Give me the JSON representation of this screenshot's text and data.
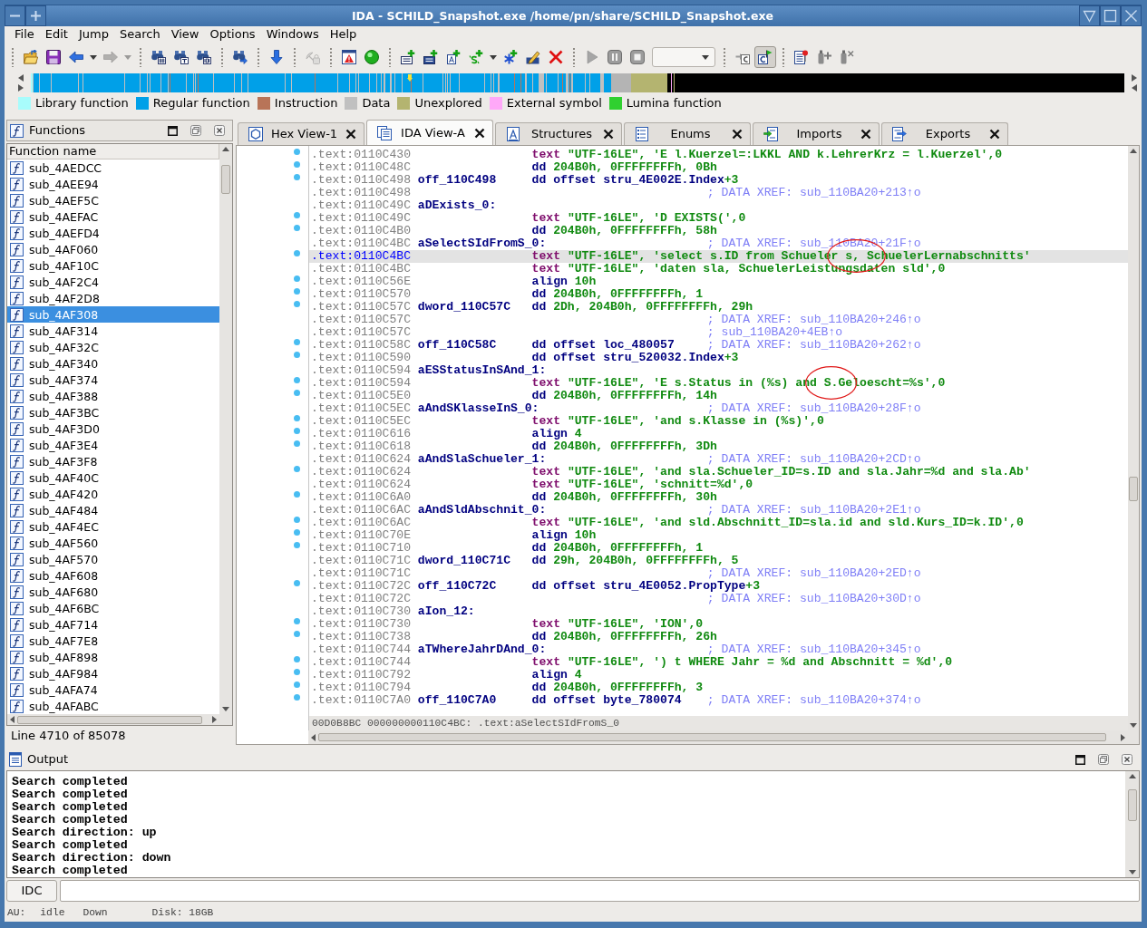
{
  "window": {
    "title": "IDA - SCHILD_Snapshot.exe /home/pn/share/SCHILD_Snapshot.exe"
  },
  "menu": [
    "File",
    "Edit",
    "Jump",
    "Search",
    "View",
    "Options",
    "Windows",
    "Help"
  ],
  "toolbar": [
    [
      {
        "kind": "folder",
        "disabled": false,
        "pressed": false
      },
      {
        "kind": "floppy",
        "disabled": false,
        "pressed": false
      },
      {
        "kind": "back",
        "disabled": false,
        "pressed": false
      },
      {
        "kind": "caret",
        "disabled": false,
        "pressed": false
      },
      {
        "kind": "forward",
        "disabled": true,
        "pressed": false
      },
      {
        "kind": "caret",
        "disabled": true,
        "pressed": false
      }
    ],
    [
      {
        "kind": "findhex",
        "disabled": false,
        "pressed": false
      },
      {
        "kind": "findtext",
        "disabled": false,
        "pressed": false
      },
      {
        "kind": "findnum",
        "disabled": false,
        "pressed": false
      }
    ],
    [
      {
        "kind": "findnext",
        "disabled": false,
        "pressed": false
      }
    ],
    [
      {
        "kind": "jumpdown",
        "disabled": false,
        "pressed": false
      }
    ],
    [
      {
        "kind": "satellite",
        "disabled": true,
        "pressed": false
      }
    ],
    [
      {
        "kind": "warning",
        "disabled": false,
        "pressed": false
      },
      {
        "kind": "greendot",
        "disabled": false,
        "pressed": false
      }
    ],
    [
      {
        "kind": "code",
        "disabled": false,
        "pressed": false
      },
      {
        "kind": "data",
        "disabled": false,
        "pressed": false
      },
      {
        "kind": "struct",
        "disabled": false,
        "pressed": false
      },
      {
        "kind": "string",
        "disabled": false,
        "pressed": false
      },
      {
        "kind": "caret",
        "disabled": false,
        "pressed": false
      },
      {
        "kind": "asterisk",
        "disabled": false,
        "pressed": false
      },
      {
        "kind": "pencil",
        "disabled": false,
        "pressed": false
      },
      {
        "kind": "undefine",
        "disabled": false,
        "pressed": false
      }
    ],
    [
      {
        "kind": "play",
        "disabled": false,
        "pressed": false
      },
      {
        "kind": "pause",
        "disabled": false,
        "pressed": false
      },
      {
        "kind": "stop",
        "disabled": false,
        "pressed": false
      },
      {
        "kind": "combo",
        "disabled": false,
        "pressed": false
      }
    ],
    [
      {
        "kind": "gotoc",
        "disabled": false,
        "pressed": false
      },
      {
        "kind": "cflag",
        "disabled": false,
        "pressed": true
      }
    ],
    [
      {
        "kind": "pindoc",
        "disabled": false,
        "pressed": false
      },
      {
        "kind": "plugadd",
        "disabled": false,
        "pressed": false
      },
      {
        "kind": "plugdel",
        "disabled": false,
        "pressed": false
      }
    ]
  ],
  "legend": [
    {
      "label": "Library function",
      "color": "#a8fcfc"
    },
    {
      "label": "Regular function",
      "color": "#00a0e8"
    },
    {
      "label": "Instruction",
      "color": "#b87458"
    },
    {
      "label": "Data",
      "color": "#c0c0c0"
    },
    {
      "label": "Unexplored",
      "color": "#b4b470"
    },
    {
      "label": "External symbol",
      "color": "#ffa8f8"
    },
    {
      "label": "Lumina function",
      "color": "#30d030"
    }
  ],
  "functions_panel": {
    "title": "Functions",
    "column": "Function name",
    "items": [
      {
        "name": "sub_4AEDCC",
        "selected": false
      },
      {
        "name": "sub_4AEE94",
        "selected": false
      },
      {
        "name": "sub_4AEF5C",
        "selected": false
      },
      {
        "name": "sub_4AEFAC",
        "selected": false
      },
      {
        "name": "sub_4AEFD4",
        "selected": false
      },
      {
        "name": "sub_4AF060",
        "selected": false
      },
      {
        "name": "sub_4AF10C",
        "selected": false
      },
      {
        "name": "sub_4AF2C4",
        "selected": false
      },
      {
        "name": "sub_4AF2D8",
        "selected": false
      },
      {
        "name": "sub_4AF308",
        "selected": true
      },
      {
        "name": "sub_4AF314",
        "selected": false
      },
      {
        "name": "sub_4AF32C",
        "selected": false
      },
      {
        "name": "sub_4AF340",
        "selected": false
      },
      {
        "name": "sub_4AF374",
        "selected": false
      },
      {
        "name": "sub_4AF388",
        "selected": false
      },
      {
        "name": "sub_4AF3BC",
        "selected": false
      },
      {
        "name": "sub_4AF3D0",
        "selected": false
      },
      {
        "name": "sub_4AF3E4",
        "selected": false
      },
      {
        "name": "sub_4AF3F8",
        "selected": false
      },
      {
        "name": "sub_4AF40C",
        "selected": false
      },
      {
        "name": "sub_4AF420",
        "selected": false
      },
      {
        "name": "sub_4AF484",
        "selected": false
      },
      {
        "name": "sub_4AF4EC",
        "selected": false
      },
      {
        "name": "sub_4AF560",
        "selected": false
      },
      {
        "name": "sub_4AF570",
        "selected": false
      },
      {
        "name": "sub_4AF608",
        "selected": false
      },
      {
        "name": "sub_4AF680",
        "selected": false
      },
      {
        "name": "sub_4AF6BC",
        "selected": false
      },
      {
        "name": "sub_4AF714",
        "selected": false
      },
      {
        "name": "sub_4AF7E8",
        "selected": false
      },
      {
        "name": "sub_4AF898",
        "selected": false
      },
      {
        "name": "sub_4AF984",
        "selected": false
      },
      {
        "name": "sub_4AFA74",
        "selected": false
      },
      {
        "name": "sub_4AFABC",
        "selected": false
      }
    ],
    "footer": "Line 4710 of 85078"
  },
  "tabs": [
    {
      "label": "Hex View-1",
      "kind": "hex",
      "selected": false
    },
    {
      "label": "IDA View-A",
      "kind": "disasm",
      "selected": true
    },
    {
      "label": "Structures",
      "kind": "struct",
      "selected": false
    },
    {
      "label": "Enums",
      "kind": "enum",
      "selected": false
    },
    {
      "label": "Imports",
      "kind": "import",
      "selected": false
    },
    {
      "label": "Exports",
      "kind": "export",
      "selected": false
    }
  ],
  "code_view": {
    "lines": [
      {
        "address": ".text:0110C430",
        "kind": "string",
        "mnemonic": "text",
        "operands": [
          {
            "text": "\"UTF-16LE\", 'E l.Kuerzel=:LKKL AND k.LehrerKrz = l.Kuerzel',0",
            "kind": "literal"
          }
        ],
        "marked": true,
        "selected": false
      },
      {
        "address": ".text:0110C48C",
        "kind": "data",
        "mnemonic": "dd",
        "operands": [
          {
            "text": "204B0h, 0FFFFFFFFh, 0Bh",
            "kind": "literal"
          }
        ],
        "marked": true,
        "selected": false
      },
      {
        "address": ".text:0110C498",
        "kind": "data",
        "label": "off_110C498",
        "mnemonic": "dd",
        "operands": [
          {
            "text": "offset stru_4E002E.Index",
            "kind": "name"
          },
          {
            "text": "+3",
            "kind": "literal"
          }
        ],
        "marked": true,
        "selected": false
      },
      {
        "address": ".text:0110C498",
        "kind": "comment",
        "comment": "; DATA XREF: sub_110BA20+213↑o",
        "marked": false,
        "selected": false
      },
      {
        "address": ".text:0110C49C",
        "kind": "label",
        "label": "aDExists_0:",
        "marked": false,
        "selected": false
      },
      {
        "address": ".text:0110C49C",
        "kind": "string",
        "mnemonic": "text",
        "operands": [
          {
            "text": "\"UTF-16LE\", 'D EXISTS(',0",
            "kind": "literal"
          }
        ],
        "marked": true,
        "selected": false
      },
      {
        "address": ".text:0110C4B0",
        "kind": "data",
        "mnemonic": "dd",
        "operands": [
          {
            "text": "204B0h, 0FFFFFFFFh, 58h",
            "kind": "literal"
          }
        ],
        "marked": true,
        "selected": false
      },
      {
        "address": ".text:0110C4BC",
        "kind": "label",
        "label": "aSelectSIdFromS_0:",
        "comment": "; DATA XREF: sub_110BA20+21F↑o",
        "marked": false,
        "selected": false
      },
      {
        "address": ".text:0110C4BC",
        "kind": "string",
        "mnemonic": "text",
        "operands": [
          {
            "text": "\"UTF-16LE\", 'select s.ID from Schuele",
            "kind": "literal"
          },
          {
            "text": "r s, Sc",
            "kind": "circled"
          },
          {
            "text": "huelerLernabschnitts'",
            "kind": "literal"
          }
        ],
        "marked": true,
        "selected": true
      },
      {
        "address": ".text:0110C4BC",
        "kind": "string",
        "mnemonic": "text",
        "operands": [
          {
            "text": "\"UTF-16LE\", 'daten sla, SchuelerLeistungsdaten sld',0",
            "kind": "literal"
          }
        ],
        "marked": false,
        "selected": false
      },
      {
        "address": ".text:0110C56E",
        "kind": "data",
        "mnemonic": "align",
        "operands": [
          {
            "text": "10h",
            "kind": "literal"
          }
        ],
        "marked": true,
        "selected": false
      },
      {
        "address": ".text:0110C570",
        "kind": "data",
        "mnemonic": "dd",
        "operands": [
          {
            "text": "204B0h, 0FFFFFFFFh, 1",
            "kind": "literal"
          }
        ],
        "marked": true,
        "selected": false
      },
      {
        "address": ".text:0110C57C",
        "kind": "data",
        "label": "dword_110C57C",
        "mnemonic": "dd",
        "operands": [
          {
            "text": "2Dh, 204B0h, 0FFFFFFFFh, 29h",
            "kind": "literal"
          }
        ],
        "marked": true,
        "selected": false
      },
      {
        "address": ".text:0110C57C",
        "kind": "comment",
        "comment": "; DATA XREF: sub_110BA20+246↑o",
        "marked": false,
        "selected": false
      },
      {
        "address": ".text:0110C57C",
        "kind": "comment",
        "comment": "; sub_110BA20+4EB↑o",
        "marked": false,
        "selected": false
      },
      {
        "address": ".text:0110C58C",
        "kind": "data",
        "label": "off_110C58C",
        "mnemonic": "dd",
        "operands": [
          {
            "text": "offset loc_480057",
            "kind": "name"
          }
        ],
        "comment": "; DATA XREF: sub_110BA20+262↑o",
        "marked": true,
        "selected": false
      },
      {
        "address": ".text:0110C590",
        "kind": "data",
        "mnemonic": "dd",
        "operands": [
          {
            "text": "offset stru_520032.Index",
            "kind": "name"
          },
          {
            "text": "+3",
            "kind": "literal"
          }
        ],
        "marked": true,
        "selected": false
      },
      {
        "address": ".text:0110C594",
        "kind": "label",
        "label": "aESStatusInSAnd_1:",
        "marked": false,
        "selected": false
      },
      {
        "address": ".text:0110C594",
        "kind": "string",
        "mnemonic": "text",
        "operands": [
          {
            "text": "\"UTF-16LE\", 'E s.Status in (%s) an",
            "kind": "literal"
          },
          {
            "text": "d S.Ge",
            "kind": "circled"
          },
          {
            "text": "loescht=%s',0",
            "kind": "literal"
          }
        ],
        "marked": true,
        "selected": false
      },
      {
        "address": ".text:0110C5E0",
        "kind": "data",
        "mnemonic": "dd",
        "operands": [
          {
            "text": "204B0h, 0FFFFFFFFh, 14h",
            "kind": "literal"
          }
        ],
        "marked": true,
        "selected": false
      },
      {
        "address": ".text:0110C5EC",
        "kind": "label",
        "label": "aAndSKlasseInS_0:",
        "comment": "; DATA XREF: sub_110BA20+28F↑o",
        "marked": false,
        "selected": false
      },
      {
        "address": ".text:0110C5EC",
        "kind": "string",
        "mnemonic": "text",
        "operands": [
          {
            "text": "\"UTF-16LE\", 'and s.Klasse in (%s)',0",
            "kind": "literal"
          }
        ],
        "marked": true,
        "selected": false
      },
      {
        "address": ".text:0110C616",
        "kind": "data",
        "mnemonic": "align",
        "operands": [
          {
            "text": "4",
            "kind": "literal"
          }
        ],
        "marked": true,
        "selected": false
      },
      {
        "address": ".text:0110C618",
        "kind": "data",
        "mnemonic": "dd",
        "operands": [
          {
            "text": "204B0h, 0FFFFFFFFh, 3Dh",
            "kind": "literal"
          }
        ],
        "marked": true,
        "selected": false
      },
      {
        "address": ".text:0110C624",
        "kind": "label",
        "label": "aAndSlaSchueler_1:",
        "comment": "; DATA XREF: sub_110BA20+2CD↑o",
        "marked": false,
        "selected": false
      },
      {
        "address": ".text:0110C624",
        "kind": "string",
        "mnemonic": "text",
        "operands": [
          {
            "text": "\"UTF-16LE\", 'and sla.Schueler_ID=s.ID and sla.Jahr=%d and sla.Ab'",
            "kind": "literal"
          }
        ],
        "marked": true,
        "selected": false
      },
      {
        "address": ".text:0110C624",
        "kind": "string",
        "mnemonic": "text",
        "operands": [
          {
            "text": "\"UTF-16LE\", 'schnitt=%d',0",
            "kind": "literal"
          }
        ],
        "marked": false,
        "selected": false
      },
      {
        "address": ".text:0110C6A0",
        "kind": "data",
        "mnemonic": "dd",
        "operands": [
          {
            "text": "204B0h, 0FFFFFFFFh, 30h",
            "kind": "literal"
          }
        ],
        "marked": true,
        "selected": false
      },
      {
        "address": ".text:0110C6AC",
        "kind": "label",
        "label": "aAndSldAbschnit_0:",
        "comment": "; DATA XREF: sub_110BA20+2E1↑o",
        "marked": false,
        "selected": false
      },
      {
        "address": ".text:0110C6AC",
        "kind": "string",
        "mnemonic": "text",
        "operands": [
          {
            "text": "\"UTF-16LE\", 'and sld.Abschnitt_ID=sla.id and sld.Kurs_ID=k.ID',0",
            "kind": "literal"
          }
        ],
        "marked": true,
        "selected": false
      },
      {
        "address": ".text:0110C70E",
        "kind": "data",
        "mnemonic": "align",
        "operands": [
          {
            "text": "10h",
            "kind": "literal"
          }
        ],
        "marked": true,
        "selected": false
      },
      {
        "address": ".text:0110C710",
        "kind": "data",
        "mnemonic": "dd",
        "operands": [
          {
            "text": "204B0h, 0FFFFFFFFh, 1",
            "kind": "literal"
          }
        ],
        "marked": true,
        "selected": false
      },
      {
        "address": ".text:0110C71C",
        "kind": "data",
        "label": "dword_110C71C",
        "mnemonic": "dd",
        "operands": [
          {
            "text": "29h, 204B0h, 0FFFFFFFFh, 5",
            "kind": "literal"
          }
        ],
        "marked": false,
        "selected": false
      },
      {
        "address": ".text:0110C71C",
        "kind": "comment",
        "comment": "; DATA XREF: sub_110BA20+2ED↑o",
        "marked": false,
        "selected": false
      },
      {
        "address": ".text:0110C72C",
        "kind": "data",
        "label": "off_110C72C",
        "mnemonic": "dd",
        "operands": [
          {
            "text": "offset stru_4E0052.PropType",
            "kind": "name"
          },
          {
            "text": "+3",
            "kind": "literal"
          }
        ],
        "marked": true,
        "selected": false
      },
      {
        "address": ".text:0110C72C",
        "kind": "comment",
        "comment": "; DATA XREF: sub_110BA20+30D↑o",
        "marked": false,
        "selected": false
      },
      {
        "address": ".text:0110C730",
        "kind": "label",
        "label": "aIon_12:",
        "marked": false,
        "selected": false
      },
      {
        "address": ".text:0110C730",
        "kind": "string",
        "mnemonic": "text",
        "operands": [
          {
            "text": "\"UTF-16LE\", 'ION',0",
            "kind": "literal"
          }
        ],
        "marked": true,
        "selected": false
      },
      {
        "address": ".text:0110C738",
        "kind": "data",
        "mnemonic": "dd",
        "operands": [
          {
            "text": "204B0h, 0FFFFFFFFh, 26h",
            "kind": "literal"
          }
        ],
        "marked": true,
        "selected": false
      },
      {
        "address": ".text:0110C744",
        "kind": "label",
        "label": "aTWhereJahrDAnd_0:",
        "comment": "; DATA XREF: sub_110BA20+345↑o",
        "marked": false,
        "selected": false
      },
      {
        "address": ".text:0110C744",
        "kind": "string",
        "mnemonic": "text",
        "operands": [
          {
            "text": "\"UTF-16LE\", ') t WHERE Jahr = %d and Abschnitt = %d',0",
            "kind": "literal"
          }
        ],
        "marked": true,
        "selected": false
      },
      {
        "address": ".text:0110C792",
        "kind": "data",
        "mnemonic": "align",
        "operands": [
          {
            "text": "4",
            "kind": "literal"
          }
        ],
        "marked": true,
        "selected": false
      },
      {
        "address": ".text:0110C794",
        "kind": "data",
        "mnemonic": "dd",
        "operands": [
          {
            "text": "204B0h, 0FFFFFFFFh, 3",
            "kind": "literal"
          }
        ],
        "marked": true,
        "selected": false
      },
      {
        "address": ".text:0110C7A0",
        "kind": "data",
        "label": "off_110C7A0",
        "mnemonic": "dd",
        "operands": [
          {
            "text": "offset byte_780074",
            "kind": "name"
          }
        ],
        "comment": "; DATA XREF: sub_110BA20+374↑o",
        "marked": true,
        "selected": false
      }
    ],
    "location": "00D0B8BC 000000000110C4BC: .text:aSelectSIdFromS_0"
  },
  "output": {
    "title": "Output",
    "lines": [
      "Search completed",
      "Search completed",
      "Search completed",
      "Search completed",
      "Search direction: up",
      "Search completed",
      "Search direction: down",
      "Search completed"
    ]
  },
  "command": {
    "button": "IDC"
  },
  "status_bar": [
    "AU:",
    "idle",
    "Down",
    "Disk: 18GB"
  ]
}
